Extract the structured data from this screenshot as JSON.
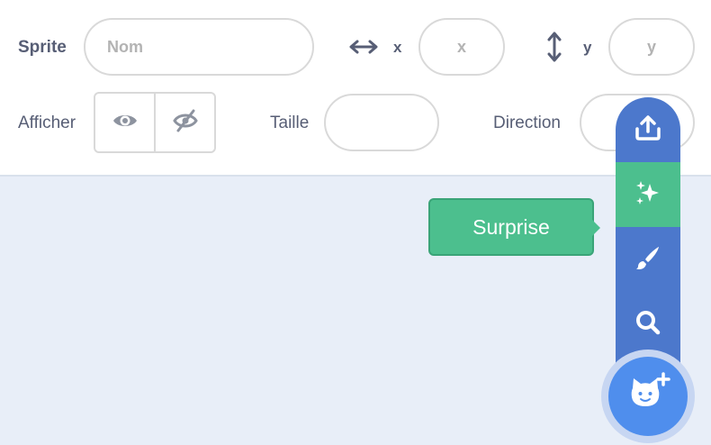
{
  "sprite": {
    "label": "Sprite",
    "name_placeholder": "Nom",
    "x_label": "x",
    "x_placeholder": "x",
    "y_label": "y",
    "y_placeholder": "y"
  },
  "show": {
    "label": "Afficher"
  },
  "size": {
    "label": "Taille",
    "value": ""
  },
  "direction": {
    "label": "Direction",
    "value": ""
  },
  "sprite_menu": {
    "items": [
      {
        "icon": "upload-icon"
      },
      {
        "icon": "sparkle-icon",
        "active": true
      },
      {
        "icon": "paintbrush-icon"
      },
      {
        "icon": "search-icon"
      }
    ],
    "main_icon": "cat-add-icon",
    "tooltip": "Surprise"
  },
  "colors": {
    "menu_blue": "#4c78cc",
    "surprise_green": "#4cbf8e",
    "button_blue": "#4f8eed",
    "stage_bg": "#e8eef8",
    "text": "#575e75"
  }
}
